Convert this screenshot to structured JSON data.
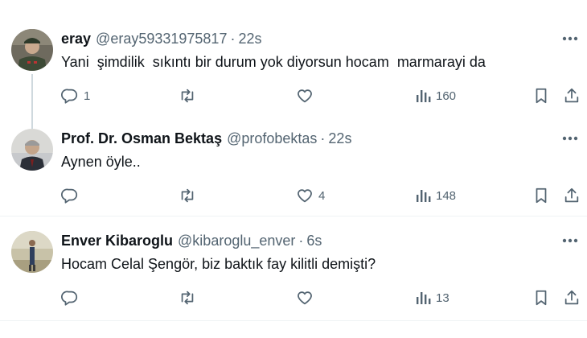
{
  "tweets": [
    {
      "name": "eray",
      "handle": "@eray59331975817",
      "separator": "·",
      "time": "22s",
      "text": "Yani  şimdilik  sıkıntı bir durum yok diyorsun hocam  marmarayi da",
      "replies": "1",
      "retweets": "",
      "likes": "",
      "views": "160"
    },
    {
      "name": "Prof. Dr. Osman Bektaş",
      "handle": "@profobektas",
      "separator": "·",
      "time": "22s",
      "text": "Aynen öyle..",
      "replies": "",
      "retweets": "",
      "likes": "4",
      "views": "148"
    },
    {
      "name": "Enver Kibaroglu",
      "handle": "@kibaroglu_enver",
      "separator": "·",
      "time": "6s",
      "text": "Hocam Celal Şengör, biz baktık fay kilitli demişti?",
      "replies": "",
      "retweets": "",
      "likes": "",
      "views": "13"
    }
  ],
  "colors": {
    "text": "#0f1419",
    "secondary": "#536471",
    "divider": "#eff3f4",
    "thread_line": "#cfd9de"
  },
  "icons": [
    "reply-icon",
    "retweet-icon",
    "like-icon",
    "views-icon",
    "bookmark-icon",
    "share-icon",
    "more-icon"
  ]
}
